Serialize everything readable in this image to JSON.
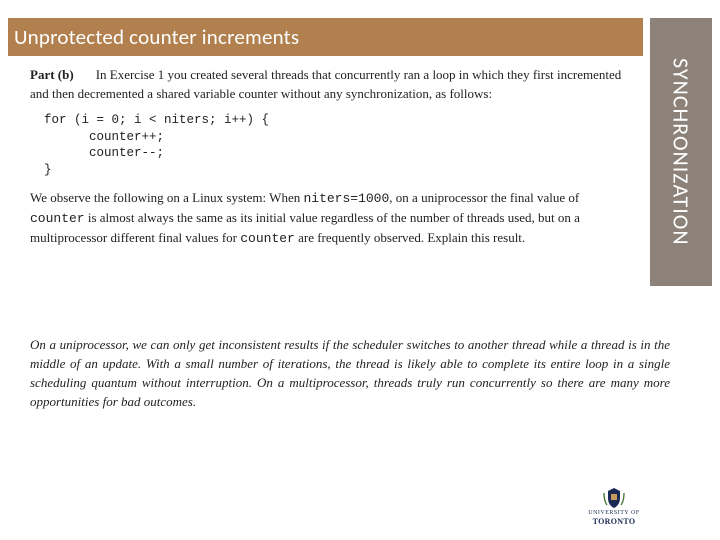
{
  "header": {
    "title": "Unprotected counter increments",
    "side_label": "SYNCHRONIZATION"
  },
  "body": {
    "part_label": "Part (b)",
    "intro": "In Exercise 1 you created several threads that concurrently ran a loop in which they first incremented and then decremented a shared variable counter without any synchronization, as follows:",
    "code": "for (i = 0; i < niters; i++) {\n      counter++;\n      counter--;\n}",
    "obs_a": "We observe the following on a Linux system: When ",
    "obs_tt1": "niters=1000",
    "obs_b": ", on a uniprocessor the final value of ",
    "obs_tt2": "counter",
    "obs_c": " is almost always the same as its initial value regardless of the number of threads used, but on a multiprocessor different final values for ",
    "obs_tt3": "counter",
    "obs_d": " are frequently observed. Explain this result.",
    "answer": "On a uniprocessor, we can only get inconsistent results if the scheduler switches to another thread while a thread is in the middle of an update. With a small number of iterations, the thread is likely able to complete its entire loop in a single scheduling quantum without interruption. On a multiprocessor, threads truly run concurrently so there are many more opportunities for bad outcomes."
  },
  "footer": {
    "logo_line1": "UNIVERSITY OF",
    "logo_line2": "TORONTO"
  }
}
